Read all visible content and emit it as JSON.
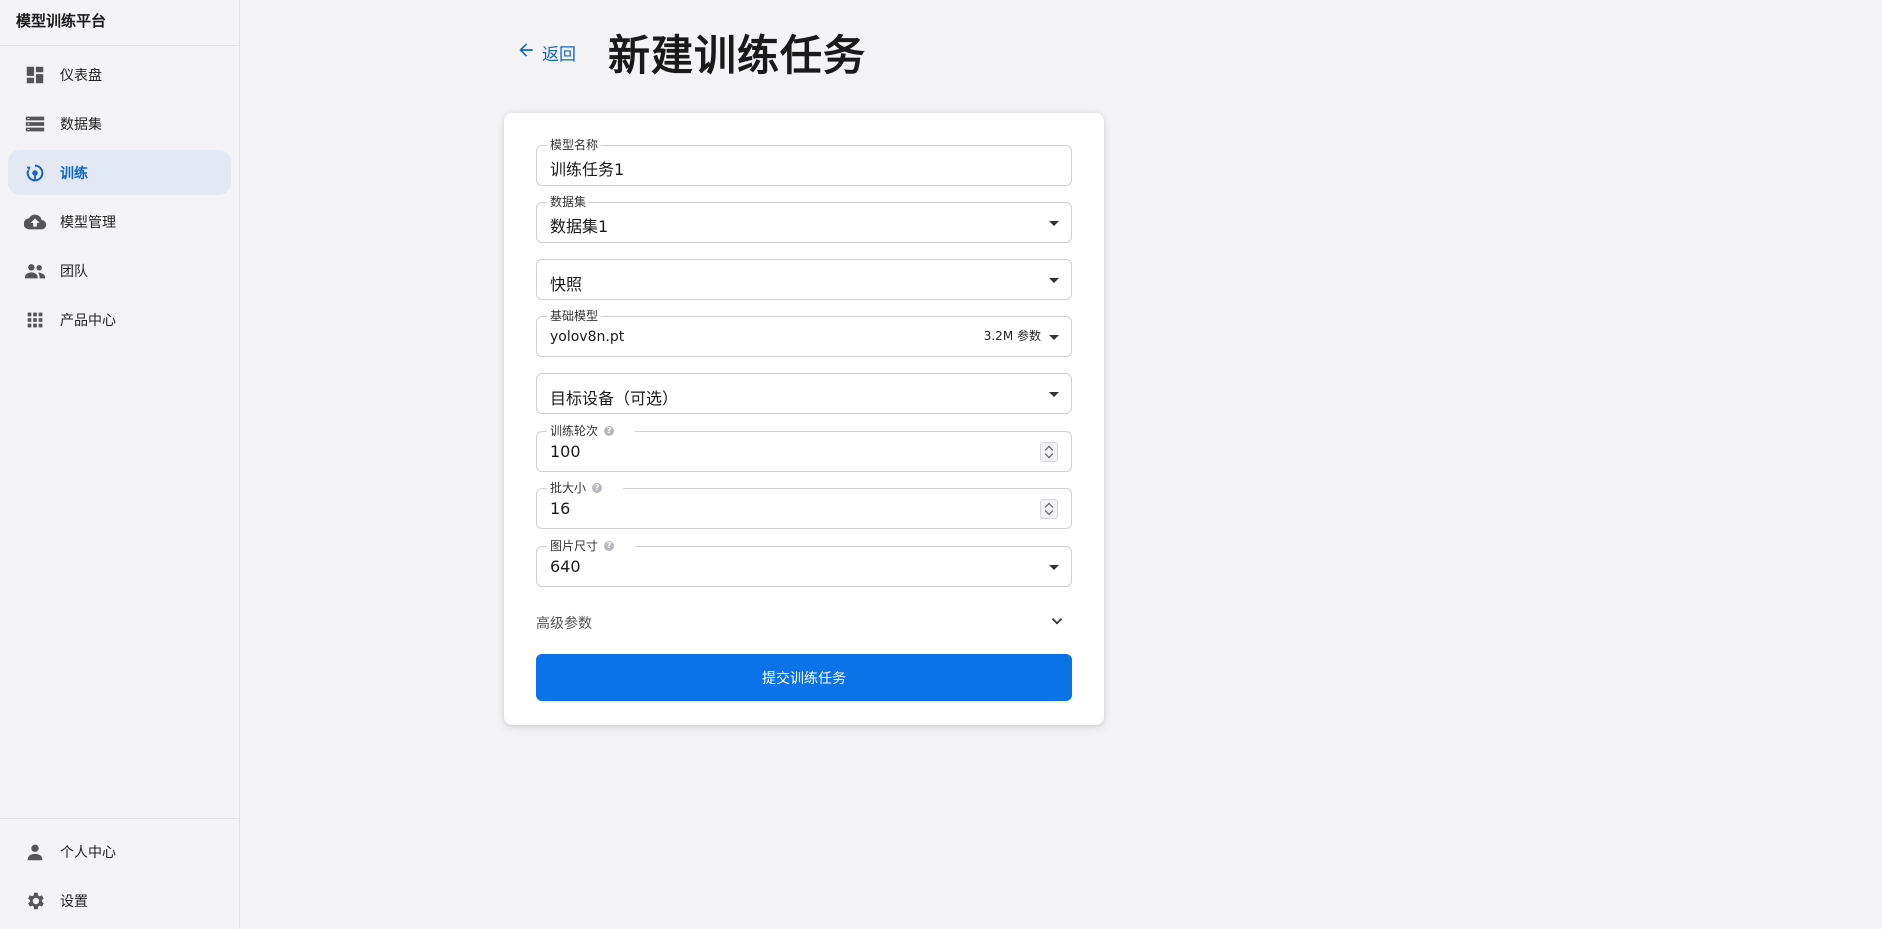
{
  "app": {
    "title": "模型训练平台"
  },
  "sidebar": {
    "items": [
      {
        "label": "仪表盘",
        "icon": "dashboard-icon"
      },
      {
        "label": "数据集",
        "icon": "dataset-icon"
      },
      {
        "label": "训练",
        "icon": "training-icon",
        "active": true
      },
      {
        "label": "模型管理",
        "icon": "cloud-upload-icon"
      },
      {
        "label": "团队",
        "icon": "team-icon"
      },
      {
        "label": "产品中心",
        "icon": "apps-grid-icon"
      }
    ],
    "bottom_items": [
      {
        "label": "个人中心",
        "icon": "person-icon"
      },
      {
        "label": "设置",
        "icon": "gear-icon"
      }
    ]
  },
  "header": {
    "back_label": "返回",
    "title": "新建训练任务"
  },
  "form": {
    "model_name": {
      "label": "模型名称",
      "value": "训练任务1"
    },
    "dataset": {
      "label": "数据集",
      "value": "数据集1"
    },
    "snapshot": {
      "placeholder": "快照"
    },
    "base_model": {
      "label": "基础模型",
      "value": "yolov8n.pt",
      "note": "3.2M 参数"
    },
    "target_device": {
      "placeholder": "目标设备（可选）"
    },
    "epochs": {
      "label": "训练轮次",
      "value": "100",
      "help": "?"
    },
    "batch_size": {
      "label": "批大小",
      "value": "16",
      "help": "?"
    },
    "image_size": {
      "label": "图片尺寸",
      "value": "640",
      "help": "?"
    },
    "advanced_label": "高级参数",
    "submit_label": "提交训练任务"
  },
  "colors": {
    "accent": "#0b72e7",
    "active_nav_bg": "#e3e9f3",
    "active_nav_text": "#1565c0"
  }
}
